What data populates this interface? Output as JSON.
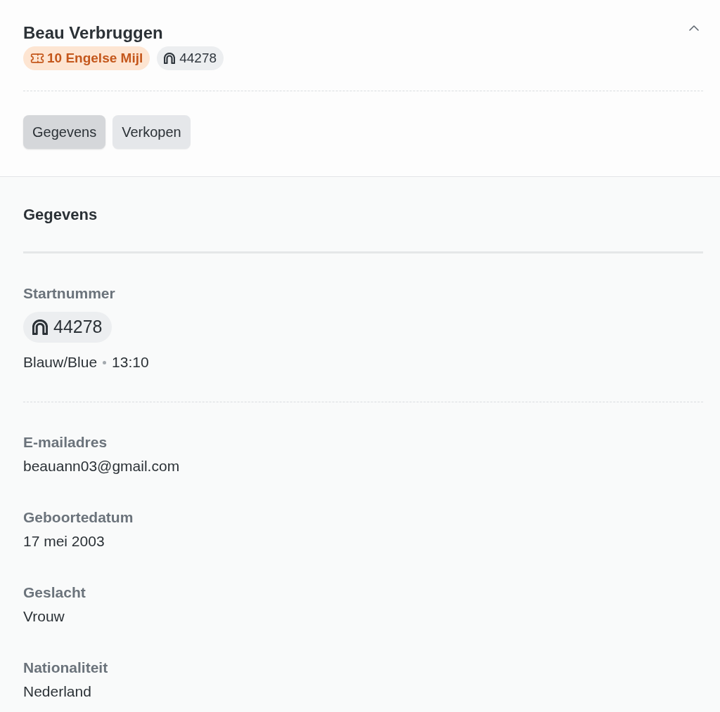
{
  "header": {
    "name": "Beau Verbruggen",
    "expanded": true,
    "badges": [
      {
        "kind": "distance",
        "text": "10 Engelse Mijl"
      },
      {
        "kind": "bib",
        "text": "44278"
      }
    ]
  },
  "tabs": [
    {
      "label": "Gegevens",
      "selected": true
    },
    {
      "label": "Verkopen",
      "selected": false
    }
  ],
  "section": {
    "title": "Gegevens",
    "start_number": {
      "label": "Startnummer",
      "bib": "44278",
      "wave": "Blauw/Blue",
      "time": "13:10"
    },
    "fields": [
      {
        "label": "E-mailadres",
        "value": "beauann03@gmail.com"
      },
      {
        "label": "Geboortedatum",
        "value": "17 mei 2003"
      },
      {
        "label": "Geslacht",
        "value": "Vrouw"
      },
      {
        "label": "Nationaliteit",
        "value": "Nederland"
      }
    ]
  }
}
